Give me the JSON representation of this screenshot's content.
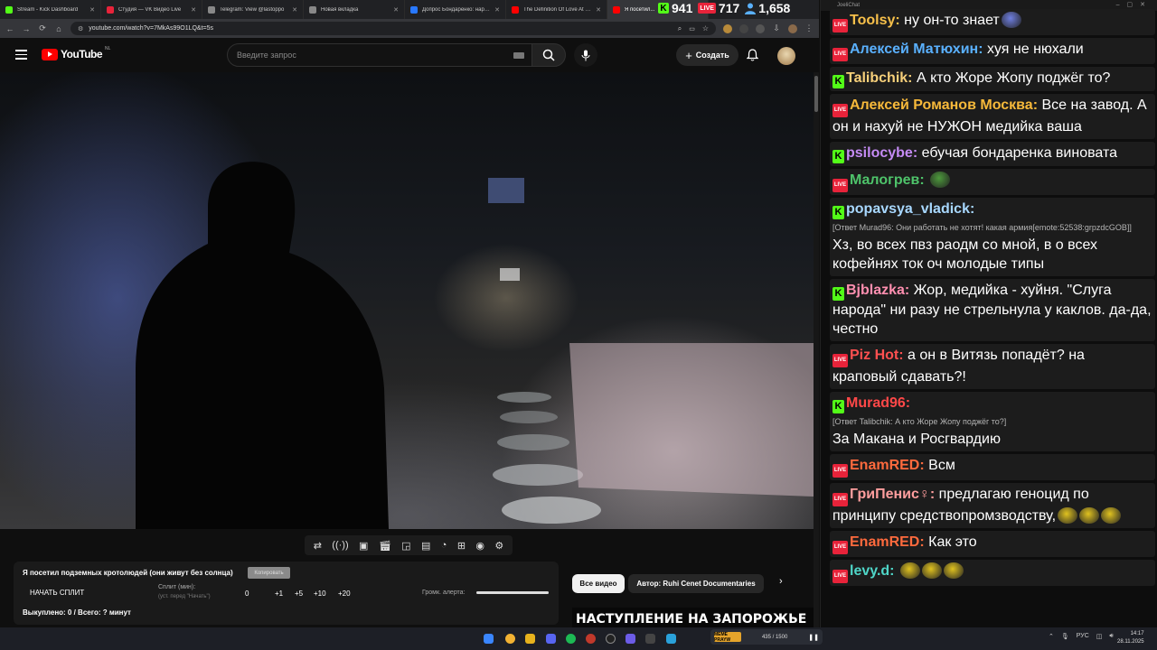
{
  "browser": {
    "tabs": [
      {
        "title": "Stream - Kick Dashboard",
        "favicon_color": "#53fc18"
      },
      {
        "title": "Студия — VK Видео Live",
        "favicon_color": "#e8233a"
      },
      {
        "title": "Telegram: View @lastoppo",
        "favicon_color": "#888888"
      },
      {
        "title": "Новая вкладка",
        "favicon_color": "#888888"
      },
      {
        "title": "Допрос Бондаренко: нарко...",
        "favicon_color": "#2878ff"
      },
      {
        "title": "The Definition Of Love At Fi...",
        "favicon_color": "#ff0000"
      },
      {
        "title": "Я посетил...",
        "favicon_color": "#ff0000"
      }
    ],
    "url": "youtube.com/watch?v=7MkAs99O1LQ&t=5s"
  },
  "stats": {
    "kick": "941",
    "live": "717",
    "viewers": "1,658",
    "live_badge": "LIVE",
    "kick_badge": "K"
  },
  "youtube": {
    "logo_text": "YouTube",
    "region": "NL",
    "search_placeholder": "Введите запрос",
    "create_label": "Создать"
  },
  "player_controls": [
    "repeat-icon",
    "broadcast-icon",
    "screen-icon",
    "clapper-icon",
    "pip-icon",
    "captions-icon",
    "speed-icon",
    "add-clip-icon",
    "camera-icon",
    "settings-icon"
  ],
  "split_panel": {
    "video_title": "Я посетил подземных кротолюдей (они живут без солнца)",
    "copy_label": "Копировать",
    "start_split": "НАЧАТЬ СПЛИТ",
    "split_label": "Сплит (мин):",
    "split_sub": "(уст. перед \"Начать\")",
    "split_value": "0",
    "increments": [
      "+1",
      "+5",
      "+10",
      "+20"
    ],
    "alert_label": "Громк. алерта:",
    "alert_level": 1.0,
    "bought": "Выкуплено: 0 / Всего: ? минут"
  },
  "chips": {
    "all": "Все видео",
    "author": "Автор: Ruhi Cenet Documentaries"
  },
  "thumb_caption": "НАСТУПЛЕНИЕ НА ЗАПОРОЖЬЕ",
  "chat": {
    "window_title": "JoeliChat",
    "messages": [
      {
        "platform": "live",
        "nick": "Toolsy",
        "color": "#f7c04a",
        "text": "ну он-то знает",
        "emotes": [
          "#6f7fe0"
        ]
      },
      {
        "platform": "live",
        "nick": "Алексей Матюхин",
        "color": "#5ab1ff",
        "text": "хуя не нюхали"
      },
      {
        "platform": "kick",
        "nick": "Talibchik",
        "color": "#f7d07a",
        "text": "А кто Жоре Жопу поджёг то?"
      },
      {
        "platform": "live",
        "nick": "Алексей Романов Москва",
        "color": "#f7b93a",
        "text": "Все на завод. А он и нахуй не НУЖОН медийка ваша"
      },
      {
        "platform": "kick",
        "nick": "psilocybe",
        "color": "#c58bf5",
        "text": "ебучая бондаренка виновата"
      },
      {
        "platform": "live",
        "nick": "Малогрев",
        "color": "#4ec36a",
        "text": "",
        "emotes": [
          "#4d9a3c"
        ]
      },
      {
        "platform": "kick",
        "nick": "popavsya_vladick",
        "color": "#a8d8ff",
        "reply": "[Ответ Murad96: Они работать не хотят! какая армия[emote:52538:grpzdcGOB]]",
        "text": "Хз, во всех пвз раодм со мной, в о всех кофейнях ток оч молодые типы"
      },
      {
        "platform": "kick",
        "nick": "Bjblazka",
        "color": "#ff8fb0",
        "text": "Жор, медийка - хуйня. \"Слуга народа\" ни разу не стрельнула у каклов. да-да, честно"
      },
      {
        "platform": "live",
        "nick": "Piz Hot",
        "color": "#ff5050",
        "text": "а он в Витязь попадёт? на краповый сдавать?!"
      },
      {
        "platform": "kick",
        "nick": "Murad96",
        "color": "#ff4848",
        "reply": "[Ответ Talibchik: А кто Жоре Жопу поджёг то?]",
        "text": "За Макана и Росгвардию"
      },
      {
        "platform": "live",
        "nick": "EnamRED",
        "color": "#ff6a3d",
        "text": "Всм"
      },
      {
        "platform": "live",
        "nick": "ГриПенис♀",
        "color": "#ff9e9e",
        "text": "предлагаю геноцид по принципу средствопромзводству,",
        "emotes": [
          "#e0c21f",
          "#e0c21f",
          "#e0c21f"
        ]
      },
      {
        "platform": "live",
        "nick": "EnamRED",
        "color": "#ff6a3d",
        "text": "Как это"
      },
      {
        "platform": "live",
        "nick": "levy.d",
        "color": "#4fd6c8",
        "text": "",
        "emotes": [
          "#e0c21f",
          "#e0c21f",
          "#e0c21f"
        ]
      }
    ]
  },
  "taskbar": {
    "media_title": "MEME PRAYW",
    "media_progress": "435 / 1500",
    "lang": "РУС",
    "time": "14:17",
    "date": "28.11.2025"
  }
}
